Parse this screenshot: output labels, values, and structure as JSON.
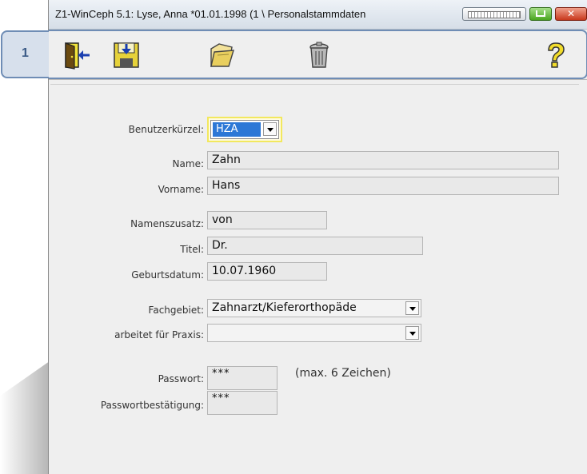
{
  "window": {
    "title": "Z1-WinCeph 5.1: Lyse, Anna *01.01.1998 (1 \\ Personalstammdaten"
  },
  "callout": {
    "number": "1"
  },
  "toolbar": {
    "items": [
      {
        "name": "exit-icon"
      },
      {
        "name": "save-icon"
      },
      {
        "name": "open-folder-icon"
      },
      {
        "name": "trash-icon"
      },
      {
        "name": "help-icon"
      }
    ]
  },
  "form": {
    "kuerzel": {
      "label": "Benutzerkürzel:",
      "value": "HZA"
    },
    "name": {
      "label": "Name:",
      "value": "Zahn"
    },
    "vorname": {
      "label": "Vorname:",
      "value": "Hans"
    },
    "namenszusatz": {
      "label": "Namenszusatz:",
      "value": "von"
    },
    "titel": {
      "label": "Titel:",
      "value": "Dr."
    },
    "geburtsdatum": {
      "label": "Geburtsdatum:",
      "value": "10.07.1960"
    },
    "fachgebiet": {
      "label": "Fachgebiet:",
      "value": "Zahnarzt/Kieferorthopäde"
    },
    "praxis": {
      "label": "arbeitet für Praxis:",
      "value": ""
    },
    "passwort": {
      "label": "Passwort:",
      "value": "***",
      "hint": "(max. 6 Zeichen)"
    },
    "passwort_bestaetigung": {
      "label": "Passwortbestätigung:",
      "value": "***"
    }
  }
}
